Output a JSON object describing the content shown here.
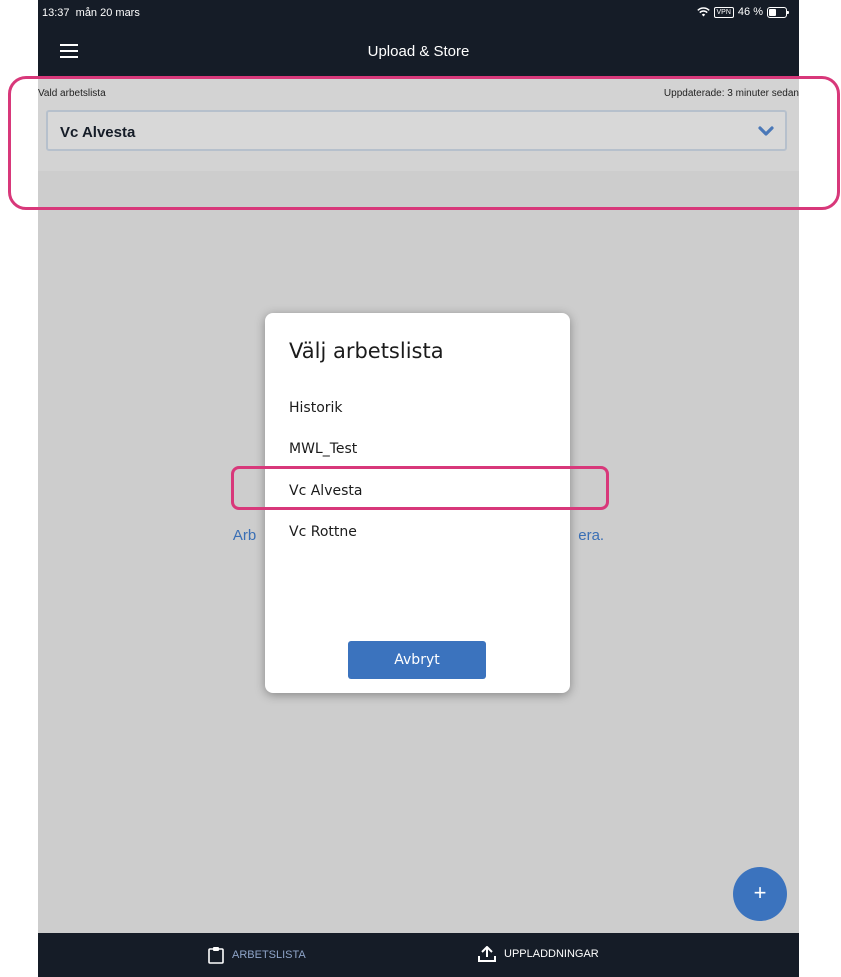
{
  "status_bar": {
    "time": "13:37",
    "date": "mån 20 mars",
    "battery": "46 %",
    "vpn": "VPN"
  },
  "app_bar": {
    "title": "Upload & Store"
  },
  "worklist": {
    "label": "Vald arbetslista",
    "updated": "Uppdaterade:  3 minuter sedan",
    "selected": "Vc Alvesta"
  },
  "hint": {
    "text_left": "Arb",
    "text_right": "era."
  },
  "dialog": {
    "title": "Välj arbetslista",
    "options": [
      "Historik",
      "MWL_Test",
      "Vc Alvesta",
      "Vc Rottne"
    ],
    "cancel_label": "Avbryt"
  },
  "fab": {
    "label": "+"
  },
  "bottom_nav": {
    "worklist_label": "ARBETSLISTA",
    "uploads_label": "UPPLADDNINGAR"
  },
  "colors": {
    "accent": "#3b73be",
    "dark": "#151c27",
    "highlight": "#d8387a"
  }
}
